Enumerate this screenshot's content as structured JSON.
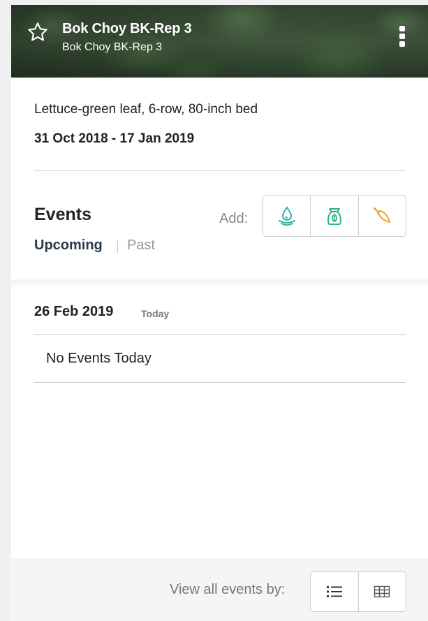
{
  "header": {
    "title": "Bok Choy BK-Rep 3",
    "subtitle": "Bok Choy BK-Rep 3",
    "star_icon": "star-outline-icon",
    "menu_icon": "kebab-menu-icon"
  },
  "info": {
    "crop_description": "Lettuce-green leaf, 6-row, 80-inch bed",
    "date_range": "31 Oct 2018 - 17 Jan 2019"
  },
  "events": {
    "title": "Events",
    "add_label": "Add:",
    "add_buttons": [
      {
        "icon": "water-drop-icon",
        "color": "#2bb5a8"
      },
      {
        "icon": "seed-bag-icon",
        "color": "#2bb58a"
      },
      {
        "icon": "trowel-icon",
        "color": "#f0a020"
      }
    ],
    "tabs": {
      "upcoming": "Upcoming",
      "separator": "|",
      "past": "Past"
    }
  },
  "day": {
    "date": "26 Feb 2019",
    "badge": "Today",
    "empty_message": "No Events Today"
  },
  "footer": {
    "view_label": "View all events by:",
    "view_buttons": [
      "list-view-icon",
      "table-view-icon"
    ]
  }
}
